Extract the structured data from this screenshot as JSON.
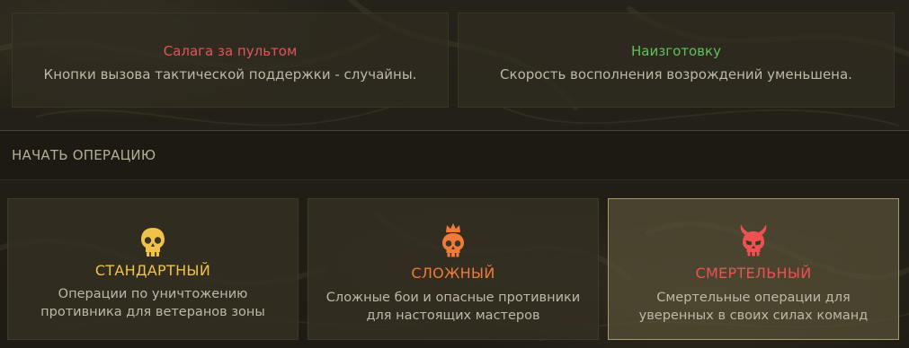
{
  "modifiers": [
    {
      "title": "Салага за пультом",
      "description": "Кнопки вызова тактической поддержки - случайны.",
      "color": "#e0565b"
    },
    {
      "title": "Наизготовку",
      "description": "Скорость восполнения возрождений уменьшена.",
      "color": "#5fc25a"
    }
  ],
  "section": {
    "title": "НАЧАТЬ ОПЕРАЦИЮ"
  },
  "operations": [
    {
      "title": "СТАНДАРТНЫЙ",
      "description_lines": [
        "Операции по уничтожению",
        "противника для ветеранов зоны"
      ],
      "icon": "skull-icon",
      "color": "#f0c24a"
    },
    {
      "title": "СЛОЖНЫЙ",
      "description_lines": [
        "Сложные бои и опасные противники",
        "для настоящих мастеров"
      ],
      "icon": "crowned-skull-icon",
      "color": "#f07a3a"
    },
    {
      "title": "СМЕРТЕЛЬНЫЙ",
      "description_lines": [
        "Смертельные операции для",
        "уверенных в своих силах команд"
      ],
      "icon": "horned-skull-icon",
      "color": "#ee5152",
      "selected": true
    }
  ]
}
